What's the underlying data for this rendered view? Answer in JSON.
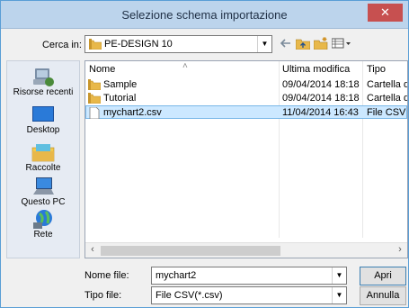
{
  "window": {
    "title": "Selezione schema importazione",
    "close": "✕"
  },
  "toolbar": {
    "lookin_label": "Cerca in:",
    "lookin_value": "PE-DESIGN 10",
    "back": "🡐",
    "up": "⬑",
    "newfolder": "✱",
    "views": "▦▾"
  },
  "places": [
    {
      "label": "Risorse recenti",
      "icon": "recent-places-icon"
    },
    {
      "label": "Desktop",
      "icon": "desktop-icon"
    },
    {
      "label": "Raccolte",
      "icon": "libraries-icon"
    },
    {
      "label": "Questo PC",
      "icon": "this-pc-icon"
    },
    {
      "label": "Rete",
      "icon": "network-icon"
    }
  ],
  "list": {
    "columns": [
      "Nome",
      "Ultima modifica",
      "Tipo"
    ],
    "sort_indicator": "˄",
    "rows": [
      {
        "name": "Sample",
        "date": "09/04/2014 18:18",
        "type": "Cartella di",
        "kind": "folder"
      },
      {
        "name": "Tutorial",
        "date": "09/04/2014 18:18",
        "type": "Cartella di",
        "kind": "folder"
      },
      {
        "name": "mychart2.csv",
        "date": "11/04/2014 16:43",
        "type": "File CSV",
        "kind": "file",
        "selected": true
      }
    ],
    "scroll_left": "‹",
    "scroll_right": "›"
  },
  "filename": {
    "label": "Nome file:",
    "value": "mychart2"
  },
  "filetype": {
    "label": "Tipo file:",
    "value": "File CSV(*.csv)"
  },
  "buttons": {
    "open": "Apri",
    "cancel": "Annulla"
  },
  "colors": {
    "title_bar": "#bcd4ec",
    "close": "#c75050",
    "selected_row": "#cce8ff",
    "folder": "#e8b84a"
  }
}
